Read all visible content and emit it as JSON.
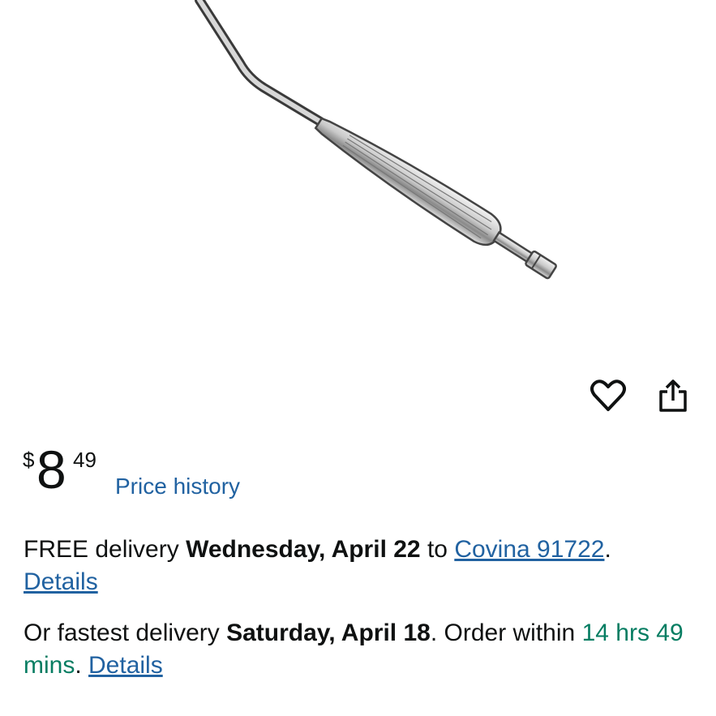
{
  "product": {
    "image_subject": "surgical suction tube instrument"
  },
  "actions": {
    "wishlist_icon": "heart-outline-icon",
    "share_icon": "share-icon"
  },
  "price": {
    "symbol": "$",
    "whole": "8",
    "fraction": "49",
    "history_label": "Price history"
  },
  "delivery": {
    "free_prefix": "FREE delivery ",
    "free_date": "Wednesday, April 22",
    "free_to": " to ",
    "location": "Covina 91722",
    "free_suffix": ".",
    "details_label": "Details",
    "fast_prefix": "Or fastest delivery ",
    "fast_date": "Saturday, April 18",
    "fast_mid": ". Order within ",
    "countdown": "14 hrs 49 mins",
    "fast_suffix": ". ",
    "fast_details_label": "Details"
  },
  "colors": {
    "link": "#2162a1",
    "countdown": "#067d62",
    "text": "#0f1111"
  }
}
